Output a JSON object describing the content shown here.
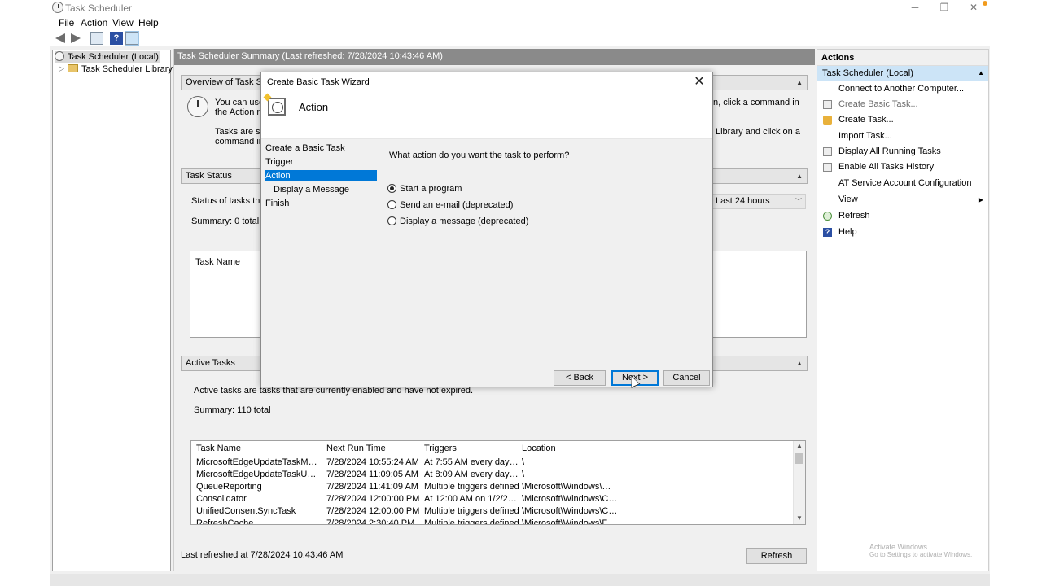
{
  "window": {
    "title": "Task Scheduler"
  },
  "menu": [
    "File",
    "Action",
    "View",
    "Help"
  ],
  "tree": {
    "root": "Task Scheduler (Local)",
    "library": "Task Scheduler Library"
  },
  "center": {
    "header": "Task Scheduler Summary (Last refreshed: 7/28/2024 10:43:46 AM)",
    "overview": {
      "title": "Overview of Task Sche",
      "line1a": "You can use T",
      "line1b": "the Action me",
      "line1c": "n, click a command in",
      "line2a": "Tasks are store",
      "line2b": "command in",
      "line2c": "Library and click on a"
    },
    "task_status": {
      "title": "Task Status",
      "status_label": "Status of tasks that h",
      "period": "Last 24 hours",
      "summary": "Summary: 0 total - 0",
      "col_task_name": "Task Name"
    },
    "active_tasks": {
      "title": "Active Tasks",
      "description": "Active tasks are tasks that are currently enabled and have not expired.",
      "summary": "Summary: 110 total",
      "columns": [
        "Task Name",
        "Next Run Time",
        "Triggers",
        "Location"
      ],
      "rows": [
        [
          "MicrosoftEdgeUpdateTaskMachine...",
          "7/28/2024 10:55:24 AM",
          "At 7:55 AM every day - Af...",
          "\\"
        ],
        [
          "MicrosoftEdgeUpdateTaskUserS-1-...",
          "7/28/2024 11:09:05 AM",
          "At 8:09 AM every day - Af...",
          "\\"
        ],
        [
          "QueueReporting",
          "7/28/2024 11:41:09 AM",
          "Multiple triggers defined",
          "\\Microsoft\\Windows\\Wi..."
        ],
        [
          "Consolidator",
          "7/28/2024 12:00:00 PM",
          "At 12:00 AM on 1/2/2004 ...",
          "\\Microsoft\\Windows\\Cus..."
        ],
        [
          "UnifiedConsentSyncTask",
          "7/28/2024 12:00:00 PM",
          "Multiple triggers defined",
          "\\Microsoft\\Windows\\Co..."
        ],
        [
          "RefreshCache",
          "7/28/2024 2:30:40 PM",
          "Multiple triggers defined",
          "\\Microsoft\\Windows\\Fli..."
        ]
      ]
    },
    "last_refreshed": "Last refreshed at 7/28/2024 10:43:46 AM",
    "refresh_button": "Refresh"
  },
  "actions": {
    "title": "Actions",
    "group": "Task Scheduler (Local)",
    "items": [
      {
        "label": "Connect to Another Computer...",
        "icon": "none"
      },
      {
        "label": "Create Basic Task...",
        "icon": "gray"
      },
      {
        "label": "Create Task...",
        "icon": "orange"
      },
      {
        "label": "Import Task...",
        "icon": "none"
      },
      {
        "label": "Display All Running Tasks",
        "icon": "gray"
      },
      {
        "label": "Enable All Tasks History",
        "icon": "gray"
      },
      {
        "label": "AT Service Account Configuration",
        "icon": "none"
      },
      {
        "label": "View",
        "icon": "none"
      },
      {
        "label": "Refresh",
        "icon": "green"
      },
      {
        "label": "Help",
        "icon": "blue"
      }
    ]
  },
  "watermark": {
    "line1": "Activate Windows",
    "line2": "Go to Settings to activate Windows."
  },
  "dialog": {
    "title": "Create Basic Task Wizard",
    "heading": "Action",
    "steps": [
      "Create a Basic Task",
      "Trigger",
      "Action",
      "Display a Message",
      "Finish"
    ],
    "question": "What action do you want the task to perform?",
    "options": [
      "Start a program",
      "Send an e-mail (deprecated)",
      "Display a message (deprecated)"
    ],
    "selected_option": "Start a program",
    "buttons": {
      "back": "< Back",
      "next": "Next >",
      "cancel": "Cancel"
    }
  }
}
